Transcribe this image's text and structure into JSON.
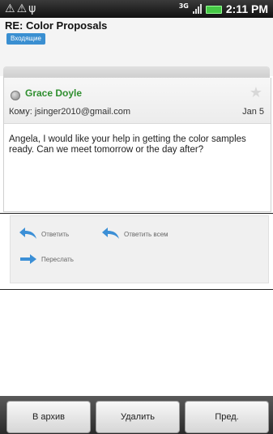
{
  "status_bar": {
    "network": "3G",
    "time": "2:11 PM",
    "icons": [
      "warning-icon",
      "warning-icon",
      "usb-icon"
    ]
  },
  "header": {
    "subject": "RE: Color Proposals",
    "folder_badge": "Входящие"
  },
  "message": {
    "sender": "Grace Doyle",
    "to": "Кому: jsinger2010@gmail.com",
    "date": "Jan 5",
    "body": "Angela, I would like your help in getting the color samples ready. Can we meet tomorrow or the day after?",
    "starred": false
  },
  "actions": {
    "reply": "Ответить",
    "reply_all": "Ответить всем",
    "forward": "Переслать"
  },
  "buttons": {
    "archive": "В архив",
    "delete": "Удалить",
    "prev": "Пред."
  },
  "colors": {
    "sender_green": "#2f8f2f",
    "badge_blue": "#3a8fd1",
    "action_blue": "#3b8fd6"
  }
}
